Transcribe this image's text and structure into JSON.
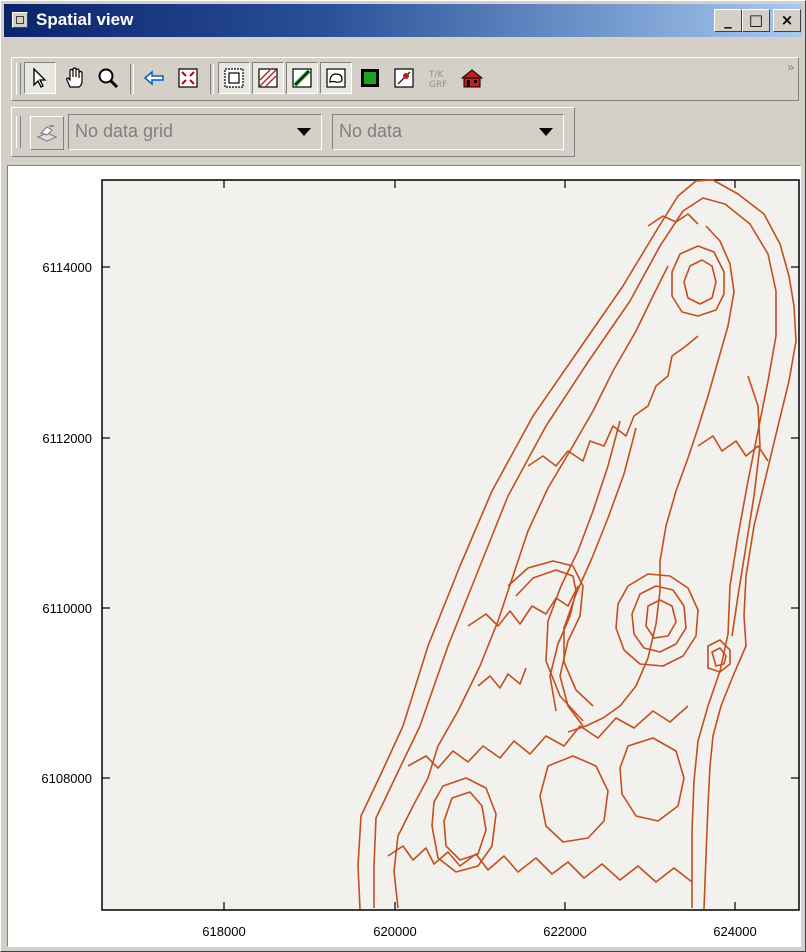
{
  "window": {
    "title": "Spatial view",
    "caption_buttons": {
      "minimize": "_",
      "maximize": "□",
      "close": "×"
    }
  },
  "toolbar_main": {
    "overflow_label": "»",
    "tools": [
      "select-arrow-icon",
      "pan-hand-icon",
      "zoom-magnifier-icon",
      "back-arrow-icon",
      "zoom-extent-icon",
      "layer-frame-icon",
      "layer-hatch-icon",
      "layer-stripe-icon",
      "layer-contour-icon",
      "layer-green-grid-icon",
      "layer-point-icon",
      "label-tool-icon",
      "house-icon"
    ]
  },
  "toolbar_data": {
    "grid_combo": {
      "value": "No data grid"
    },
    "data_combo": {
      "value": "No data"
    }
  },
  "map": {
    "plot_background": "#f3f1ed",
    "contour_color": "#c14f1f",
    "x_ticks": [
      "618000",
      "620000",
      "622000",
      "624000"
    ],
    "y_ticks": [
      "6114000",
      "6112000",
      "6110000",
      "6108000"
    ]
  }
}
